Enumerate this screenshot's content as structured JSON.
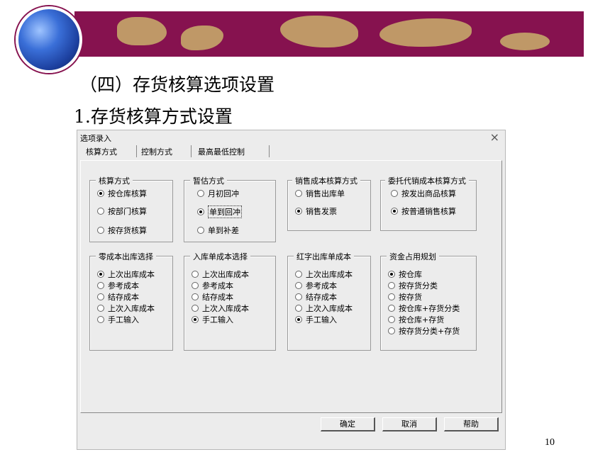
{
  "slide": {
    "heading1": "（四）存货核算选项设置",
    "heading2": "1.存货核算方式设置",
    "page_number": "10"
  },
  "dialog": {
    "title": "选项录入",
    "close_symbol": "×",
    "tabs": [
      "核算方式",
      "控制方式",
      "最高最低控制"
    ],
    "groups": [
      {
        "title": "核算方式",
        "options": [
          "按仓库核算",
          "按部门核算",
          "按存货核算"
        ],
        "selected": 0
      },
      {
        "title": "暂估方式",
        "options": [
          "月初回冲",
          "单到回冲",
          "单到补差"
        ],
        "selected": 1
      },
      {
        "title": "销售成本核算方式",
        "options": [
          "销售出库单",
          "销售发票"
        ],
        "selected": 1
      },
      {
        "title": "委托代销成本核算方式",
        "options": [
          "按发出商品核算",
          "按普通销售核算"
        ],
        "selected": 1
      },
      {
        "title": "零成本出库选择",
        "options": [
          "上次出库成本",
          "参考成本",
          "结存成本",
          "上次入库成本",
          "手工输入"
        ],
        "selected": 0
      },
      {
        "title": "入库单成本选择",
        "options": [
          "上次出库成本",
          "参考成本",
          "结存成本",
          "上次入库成本",
          "手工输入"
        ],
        "selected": 4
      },
      {
        "title": "红字出库单成本",
        "options": [
          "上次出库成本",
          "参考成本",
          "结存成本",
          "上次入库成本",
          "手工输入"
        ],
        "selected": 4
      },
      {
        "title": "资金占用规划",
        "options": [
          "按仓库",
          "按存货分类",
          "按存货",
          "按仓库+存货分类",
          "按仓库+存货",
          "按存货分类+存货"
        ],
        "selected": 0
      }
    ],
    "buttons": {
      "ok": "确定",
      "cancel": "取消",
      "help": "帮助"
    }
  }
}
